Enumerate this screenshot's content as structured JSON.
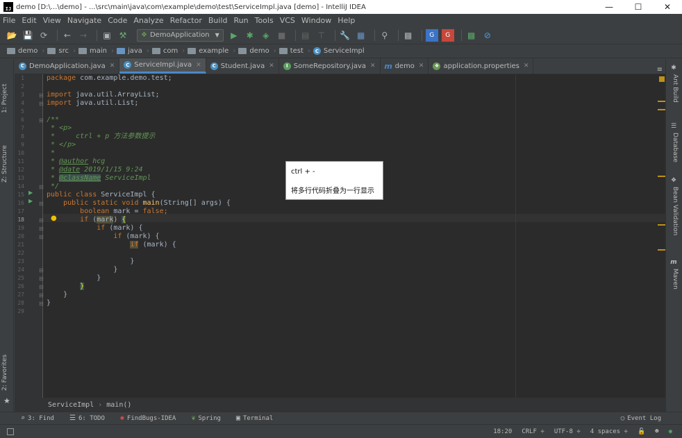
{
  "window": {
    "title": "demo [D:\\...\\demo] - ...\\src\\main\\java\\com\\example\\demo\\test\\ServiceImpl.java [demo] - IntelliJ IDEA",
    "logo": "IJ",
    "minimize": "—",
    "maximize": "☐",
    "close": "✕"
  },
  "menu": [
    "File",
    "Edit",
    "View",
    "Navigate",
    "Code",
    "Analyze",
    "Refactor",
    "Build",
    "Run",
    "Tools",
    "VCS",
    "Window",
    "Help"
  ],
  "toolbar": {
    "run_config": "DemoApplication",
    "icons": [
      "open-icon",
      "save-icon",
      "sync-icon",
      "back-icon",
      "forward-icon",
      "structure-icon",
      "build-icon",
      "run-icon",
      "debug-icon",
      "coverage-icon",
      "stop-icon",
      "settings-icon",
      "project-structure-icon",
      "search-icon",
      "sdk-icon",
      "translate-icon",
      "translate2-icon",
      "memory-icon",
      "no-icon"
    ]
  },
  "breadcrumb": [
    "demo",
    "src",
    "main",
    "java",
    "com",
    "example",
    "demo",
    "test",
    "ServiceImpl"
  ],
  "tabs": [
    {
      "label": "DemoApplication.java",
      "icon": "C",
      "active": false
    },
    {
      "label": "ServiceImpl.java",
      "icon": "C",
      "active": true
    },
    {
      "label": "Student.java",
      "icon": "C",
      "active": false
    },
    {
      "label": "SomeRepository.java",
      "icon": "I",
      "active": false
    },
    {
      "label": "demo",
      "icon": "m",
      "active": false
    },
    {
      "label": "application.properties",
      "icon": "leaf",
      "active": false
    }
  ],
  "tab_menu": "≡",
  "left_tools": [
    "1: Project",
    "Z: Structure",
    "2: Favorites"
  ],
  "right_tools": [
    "Ant Build",
    "Database",
    "Bean Validation",
    "Maven"
  ],
  "code": {
    "line_numbers": [
      "1",
      "2",
      "3",
      "4",
      "5",
      "6",
      "7",
      "8",
      "9",
      "10",
      "11",
      "12",
      "13",
      "14",
      "15",
      "16",
      "17",
      "18",
      "19",
      "20",
      "21",
      "22",
      "23",
      "24",
      "25",
      "26",
      "27",
      "28",
      "29"
    ],
    "current_line": 18,
    "text": {
      "l1_kw": "package",
      "l1_rest": " com.example.demo.test;",
      "l3_kw": "import",
      "l3_rest": " java.util.ArrayList;",
      "l4_kw": "import",
      "l4_rest": " java.util.List;",
      "l6": "/**",
      "l7_a": " * ",
      "l7_tag": "<p>",
      "l8": " *     ctrl + p 方法参数提示",
      "l9_a": " * ",
      "l9_tag": "</p>",
      "l10": " *",
      "l11_a": " * ",
      "l11_tag": "@author",
      "l11_b": " hcg",
      "l12_a": " * ",
      "l12_tag": "@date",
      "l12_b": " 2019/1/15 9:24",
      "l13_a": " * ",
      "l13_tag": "@className",
      "l13_b": " ServiceImpl",
      "l14": " */",
      "l15_kw": "public class",
      "l15_rest": " ServiceImpl {",
      "l16_indent": "    ",
      "l16_kw": "public static void",
      "l16_sp": " ",
      "l16_fn": "main",
      "l16_rest": "(String[] args) {",
      "l17_indent": "        ",
      "l17_kw": "boolean",
      "l17_a": " mark = ",
      "l17_kw2": "false",
      "l17_b": ";",
      "l18_indent": "        ",
      "l18_kw": "if",
      "l18_a": " (",
      "l18_mark": "mark",
      "l18_b": ") ",
      "l18_brace": "{",
      "l19_indent": "            ",
      "l19_kw": "if",
      "l19_rest": " (mark) {",
      "l20_indent": "                ",
      "l20_kw": "if",
      "l20_rest": " (mark) {",
      "l21_indent": "                    ",
      "l21_kw": "if",
      "l21_rest": " (mark) {",
      "l23": "                    }",
      "l24": "                }",
      "l25": "            }",
      "l26_indent": "        ",
      "l26_brace": "}",
      "l27": "    }",
      "l28": "}"
    }
  },
  "tooltip": {
    "line1": "ctrl + -",
    "line2": "将多行代码折叠为一行显示"
  },
  "editor_breadcrumb": [
    "ServiceImpl",
    "main()"
  ],
  "bottom_tools": [
    {
      "label": "3: Find",
      "icon": "search-icon",
      "glyph": "⌕"
    },
    {
      "label": "6: TODO",
      "icon": "list-icon",
      "glyph": "☰"
    },
    {
      "label": "FindBugs-IDEA",
      "icon": "bug-icon",
      "glyph": "✱"
    },
    {
      "label": "Spring",
      "icon": "leaf-icon",
      "glyph": "❦"
    },
    {
      "label": "Terminal",
      "icon": "terminal-icon",
      "glyph": "▣"
    }
  ],
  "event_log": "Event Log",
  "status": {
    "position": "18:20",
    "line_sep": "CRLF ÷",
    "encoding": "UTF-8 ÷",
    "indent": "4 spaces ÷"
  },
  "colors": {
    "background": "#2b2b2b",
    "keyword": "#cc7832",
    "comment": "#629755",
    "function": "#ffc66d",
    "accent": "#4a88c7"
  }
}
